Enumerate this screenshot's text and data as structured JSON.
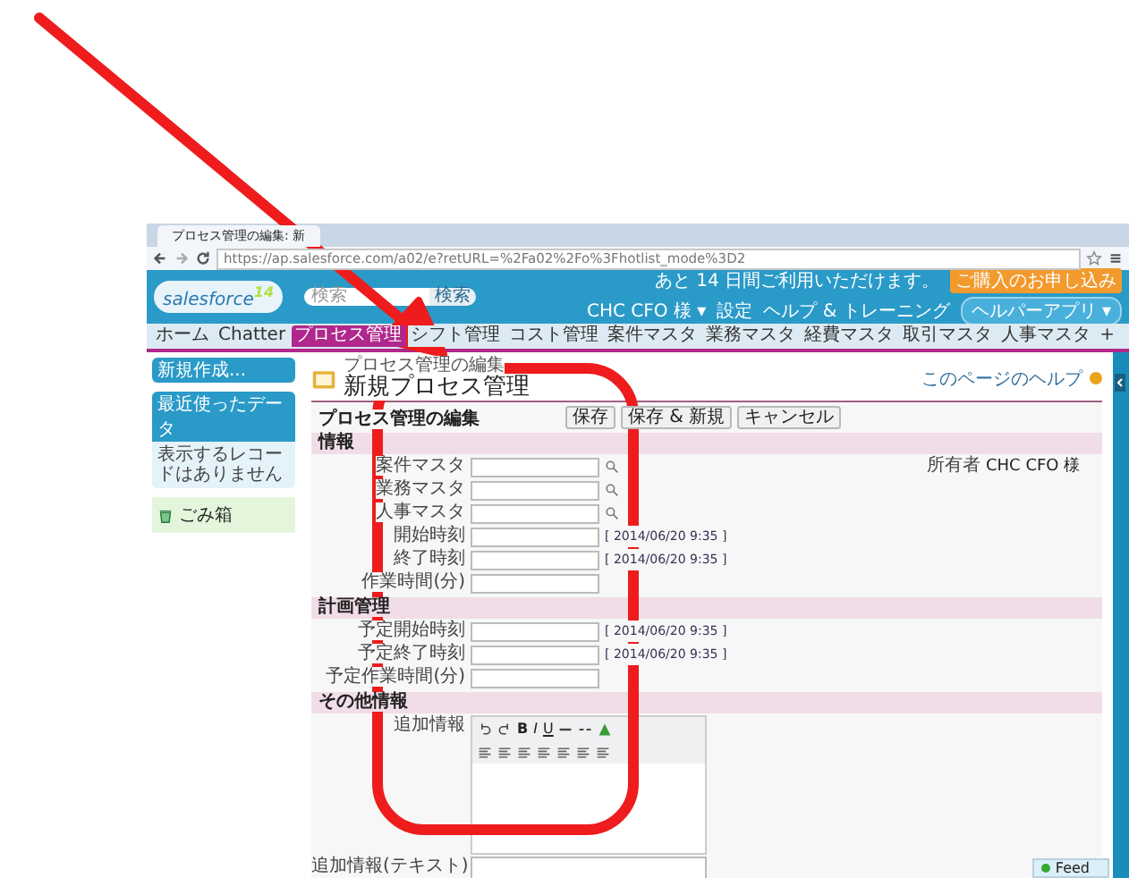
{
  "browser": {
    "tab_title": "プロセス管理の編集: 新",
    "url": "https://ap.salesforce.com/a02/e?retURL=%2Fa02%2Fo%3Fhotlist_mode%3D2"
  },
  "header": {
    "logo_text": "salesforce",
    "logo_badge": "14",
    "search_placeholder": "検索",
    "search_button": "検索",
    "trial_notice": "あと 14 日間ご利用いただけます。",
    "signup_button": "ご購入のお申し込み",
    "user_menu": "CHC CFO 様 ▾",
    "setup_link": "設定",
    "help_link": "ヘルプ & トレーニング",
    "app_menu": "ヘルパーアプリ ▾"
  },
  "nav_tabs": [
    {
      "label": "ホーム",
      "selected": false
    },
    {
      "label": "Chatter",
      "selected": false
    },
    {
      "label": "プロセス管理",
      "selected": true
    },
    {
      "label": "シフト管理",
      "selected": false
    },
    {
      "label": "コスト管理",
      "selected": false
    },
    {
      "label": "案件マスタ",
      "selected": false
    },
    {
      "label": "業務マスタ",
      "selected": false
    },
    {
      "label": "経費マスタ",
      "selected": false
    },
    {
      "label": "取引マスタ",
      "selected": false
    },
    {
      "label": "人事マスタ",
      "selected": false
    },
    {
      "label": "+",
      "selected": false
    }
  ],
  "sidebar": {
    "create_menu": "新規作成...",
    "recent_title": "最近使ったデータ",
    "recent_empty": "表示するレコードはありません",
    "recycle_bin": "ごみ箱"
  },
  "page": {
    "subtitle": "プロセス管理の編集",
    "title": "新規プロセス管理",
    "help_link": "このページのヘルプ"
  },
  "form": {
    "title": "プロセス管理の編集",
    "buttons": [
      "保存",
      "保存 & 新規",
      "キャンセル"
    ],
    "sections": [
      {
        "title": "情報",
        "fields": [
          {
            "label": "案件マスタ",
            "kind": "lookup"
          },
          {
            "label": "業務マスタ",
            "kind": "lookup"
          },
          {
            "label": "人事マスタ",
            "kind": "lookup"
          },
          {
            "label": "開始時刻",
            "kind": "datetime",
            "date_hint": "[ 2014/06/20 9:35 ]"
          },
          {
            "label": "終了時刻",
            "kind": "datetime",
            "date_hint": "[ 2014/06/20 9:35 ]"
          },
          {
            "label": "作業時間(分)",
            "kind": "text"
          }
        ],
        "right_fields": [
          {
            "label": "所有者",
            "value": "CHC CFO 様"
          }
        ]
      },
      {
        "title": "計画管理",
        "fields": [
          {
            "label": "予定開始時刻",
            "kind": "datetime",
            "date_hint": "[ 2014/06/20 9:35 ]"
          },
          {
            "label": "予定終了時刻",
            "kind": "datetime",
            "date_hint": "[ 2014/06/20 9:35 ]"
          },
          {
            "label": "予定作業時間(分)",
            "kind": "text"
          }
        ]
      },
      {
        "title": "その他情報",
        "fields": [
          {
            "label": "追加情報",
            "kind": "richtext",
            "format_buttons": [
              "B",
              "I",
              "U"
            ]
          },
          {
            "label": "追加情報(テキスト)",
            "kind": "textarea"
          }
        ]
      }
    ]
  },
  "feed_widget": {
    "label": "Feed"
  }
}
